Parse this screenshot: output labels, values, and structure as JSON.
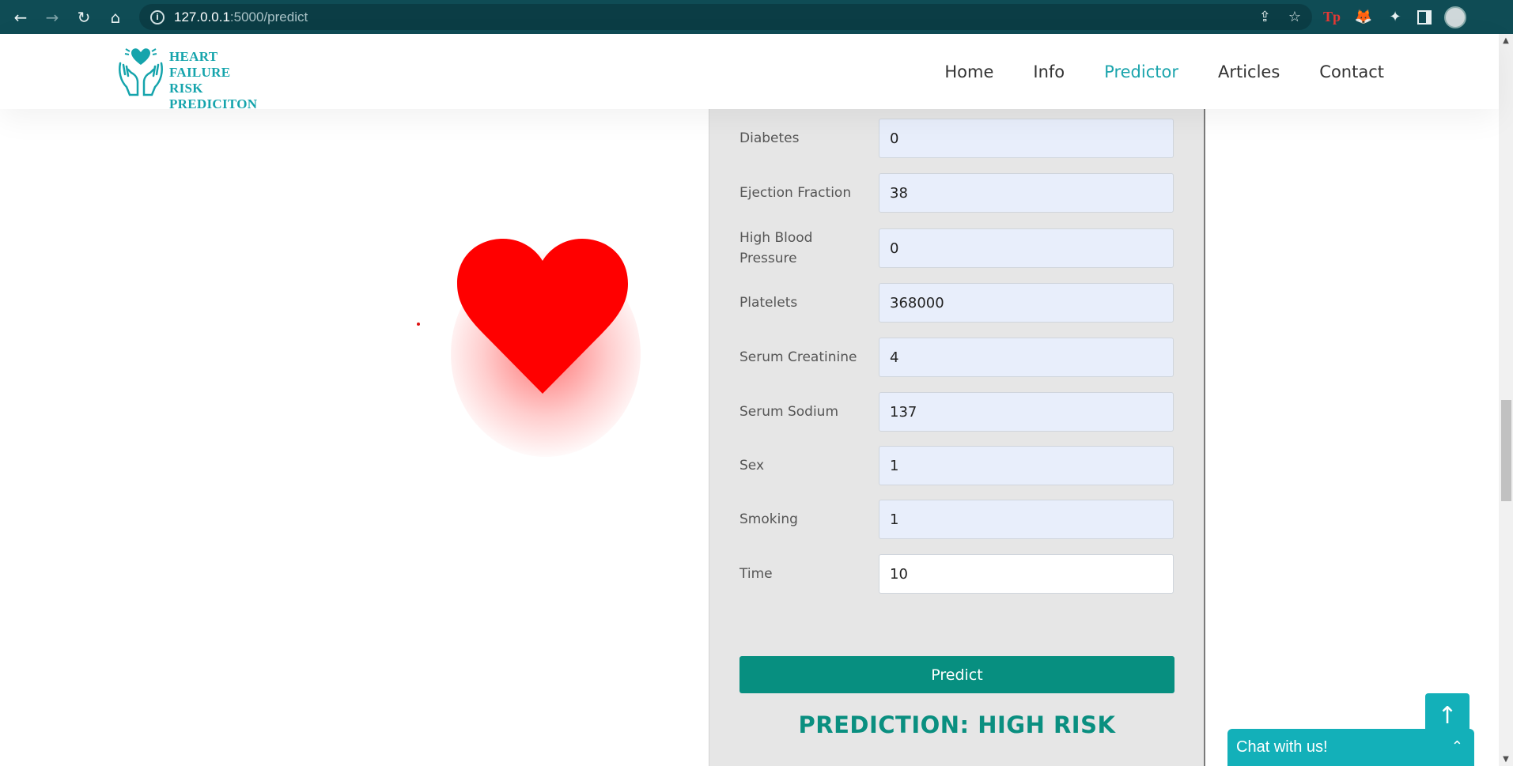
{
  "browser": {
    "back_icon": "←",
    "forward_icon": "→",
    "reload_icon": "↻",
    "home_icon": "⌂",
    "url_host": "127.0.0.1",
    "url_path": ":5000/predict",
    "share_icon": "⇪",
    "star_icon": "☆",
    "ext_tp": "Tp",
    "ext_fox": "🦊",
    "ext_puzzle": "✦"
  },
  "header": {
    "logo_line1": "HEART",
    "logo_line2": "FAILURE RISK",
    "logo_line3": "PREDICITON",
    "menu": [
      "Home",
      "Info",
      "Predictor",
      "Articles",
      "Contact"
    ],
    "active": "Predictor"
  },
  "form": {
    "fields": [
      {
        "label": "Diabetes",
        "value": "0"
      },
      {
        "label": "Ejection Fraction",
        "value": "38"
      },
      {
        "label": "High Blood Pressure",
        "value": "0"
      },
      {
        "label": "Platelets",
        "value": "368000"
      },
      {
        "label": "Serum Creatinine",
        "value": "4"
      },
      {
        "label": "Serum Sodium",
        "value": "137"
      },
      {
        "label": "Sex",
        "value": "1"
      },
      {
        "label": "Smoking",
        "value": "1"
      },
      {
        "label": "Time",
        "value": "10"
      }
    ],
    "button": "Predict",
    "result": "PREDICTION: HIGH RISK"
  },
  "widgets": {
    "to_top_icon": "↑",
    "chat_label": "Chat with us!",
    "chat_chevron": "⌃"
  },
  "colors": {
    "brand": "#13b0b9",
    "button": "#078f80",
    "heart": "#ff0000"
  }
}
